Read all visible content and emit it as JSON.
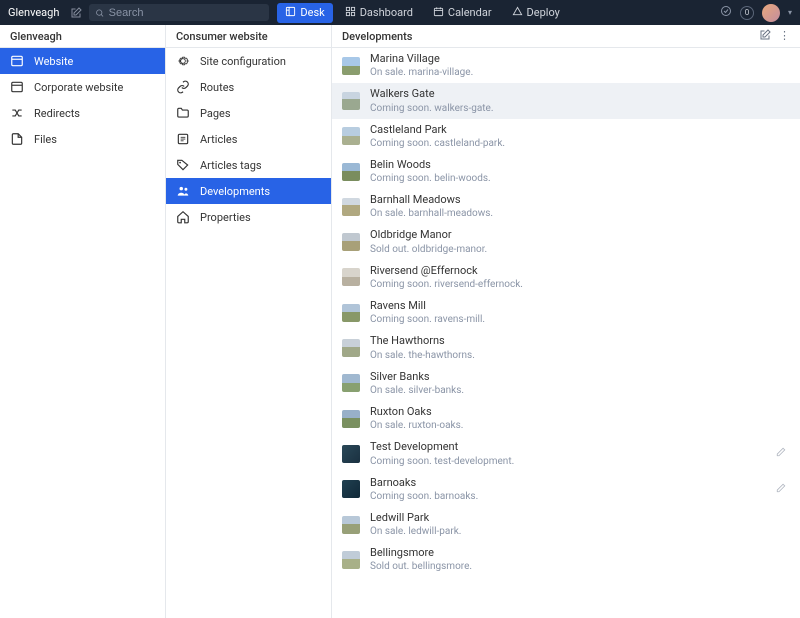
{
  "topbar": {
    "brand": "Glenveagh",
    "search_placeholder": "Search",
    "nav": [
      {
        "label": "Desk",
        "icon": "layout-icon",
        "active": true
      },
      {
        "label": "Dashboard",
        "icon": "dashboard-icon",
        "active": false
      },
      {
        "label": "Calendar",
        "icon": "calendar-icon",
        "active": false
      },
      {
        "label": "Deploy",
        "icon": "deploy-icon",
        "active": false
      }
    ],
    "badge": "0"
  },
  "col1": {
    "header": "Glenveagh",
    "items": [
      {
        "label": "Website",
        "icon": "site-icon",
        "active": true
      },
      {
        "label": "Corporate website",
        "icon": "site-icon",
        "active": false
      },
      {
        "label": "Redirects",
        "icon": "shuffle-icon",
        "active": false
      },
      {
        "label": "Files",
        "icon": "file-icon",
        "active": false
      }
    ]
  },
  "col2": {
    "header": "Consumer website",
    "items": [
      {
        "label": "Site configuration",
        "icon": "gear-icon",
        "active": false
      },
      {
        "label": "Routes",
        "icon": "link-icon",
        "active": false
      },
      {
        "label": "Pages",
        "icon": "folder-icon",
        "active": false
      },
      {
        "label": "Articles",
        "icon": "article-icon",
        "active": false
      },
      {
        "label": "Articles tags",
        "icon": "tag-icon",
        "active": false
      },
      {
        "label": "Developments",
        "icon": "people-icon",
        "active": true
      },
      {
        "label": "Properties",
        "icon": "home-icon",
        "active": false
      }
    ]
  },
  "col3": {
    "header": "Developments",
    "items": [
      {
        "title": "Marina Village",
        "subtitle": "On sale. marina-village.",
        "selected": false,
        "action": false
      },
      {
        "title": "Walkers Gate",
        "subtitle": "Coming soon. walkers-gate.",
        "selected": true,
        "action": false
      },
      {
        "title": "Castleland Park",
        "subtitle": "Coming soon. castleland-park.",
        "selected": false,
        "action": false
      },
      {
        "title": "Belin Woods",
        "subtitle": "Coming soon. belin-woods.",
        "selected": false,
        "action": false
      },
      {
        "title": "Barnhall Meadows",
        "subtitle": "On sale. barnhall-meadows.",
        "selected": false,
        "action": false
      },
      {
        "title": "Oldbridge Manor",
        "subtitle": "Sold out. oldbridge-manor.",
        "selected": false,
        "action": false
      },
      {
        "title": "Riversend @Effernock",
        "subtitle": "Coming soon. riversend-effernock.",
        "selected": false,
        "action": false
      },
      {
        "title": "Ravens Mill",
        "subtitle": "Coming soon. ravens-mill.",
        "selected": false,
        "action": false
      },
      {
        "title": "The Hawthorns",
        "subtitle": "On sale. the-hawthorns.",
        "selected": false,
        "action": false
      },
      {
        "title": "Silver Banks",
        "subtitle": "On sale. silver-banks.",
        "selected": false,
        "action": false
      },
      {
        "title": "Ruxton Oaks",
        "subtitle": "On sale. ruxton-oaks.",
        "selected": false,
        "action": false
      },
      {
        "title": "Test Development",
        "subtitle": "Coming soon. test-development.",
        "selected": false,
        "action": true
      },
      {
        "title": "Barnoaks",
        "subtitle": "Coming soon. barnoaks.",
        "selected": false,
        "action": true
      },
      {
        "title": "Ledwill Park",
        "subtitle": "On sale. ledwill-park.",
        "selected": false,
        "action": false
      },
      {
        "title": "Bellingsmore",
        "subtitle": "Sold out. bellingsmore.",
        "selected": false,
        "action": false
      }
    ]
  }
}
